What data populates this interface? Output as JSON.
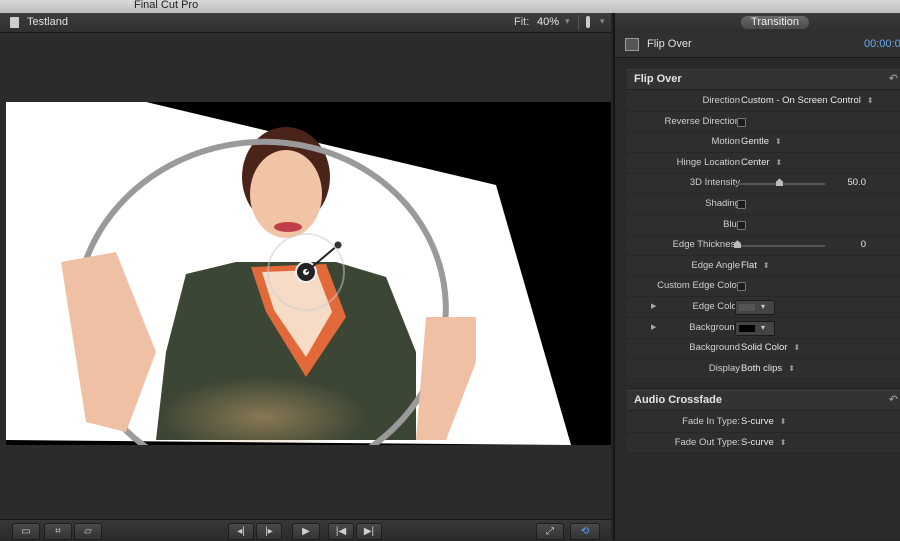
{
  "app": {
    "title": "Final Cut Pro"
  },
  "viewer": {
    "project_name": "Testland",
    "fit_label": "Fit:",
    "fit_value": "40%"
  },
  "inspector": {
    "tab": "Transition",
    "effect_name": "Flip Over",
    "timecode": "00:00:0",
    "section1": {
      "title": "Flip Over",
      "rows": [
        {
          "label": "Direction",
          "type": "popup",
          "value": "Custom - On Screen Control"
        },
        {
          "label": "Reverse Direction",
          "type": "checkbox",
          "checked": false
        },
        {
          "label": "Motion",
          "type": "popup",
          "value": "Gentle"
        },
        {
          "label": "Hinge Location",
          "type": "popup",
          "value": "Center"
        },
        {
          "label": "3D Intensity",
          "type": "slider",
          "value": "50.0",
          "fraction": 0.5
        },
        {
          "label": "Shading",
          "type": "checkbox",
          "checked": false
        },
        {
          "label": "Blur",
          "type": "checkbox",
          "checked": false
        },
        {
          "label": "Edge Thickness",
          "type": "slider",
          "value": "0",
          "fraction": 0
        },
        {
          "label": "Edge Angle",
          "type": "popup",
          "value": "Flat"
        },
        {
          "label": "Custom Edge Color",
          "type": "checkbox",
          "checked": false
        },
        {
          "label": "Edge Color",
          "type": "color",
          "color": "#555555"
        },
        {
          "label": "Background",
          "type": "color",
          "color": "#000000"
        },
        {
          "label": "Background",
          "type": "popup",
          "value": "Solid Color"
        },
        {
          "label": "Display",
          "type": "popup",
          "value": "Both clips"
        }
      ]
    },
    "section2": {
      "title": "Audio Crossfade",
      "rows": [
        {
          "label": "Fade In Type:",
          "type": "popup",
          "value": "S-curve"
        },
        {
          "label": "Fade Out Type:",
          "type": "popup",
          "value": "S-curve"
        }
      ]
    }
  },
  "colors": {
    "accent_blue": "#6aa8f0",
    "panel": "#2a2a2a"
  }
}
